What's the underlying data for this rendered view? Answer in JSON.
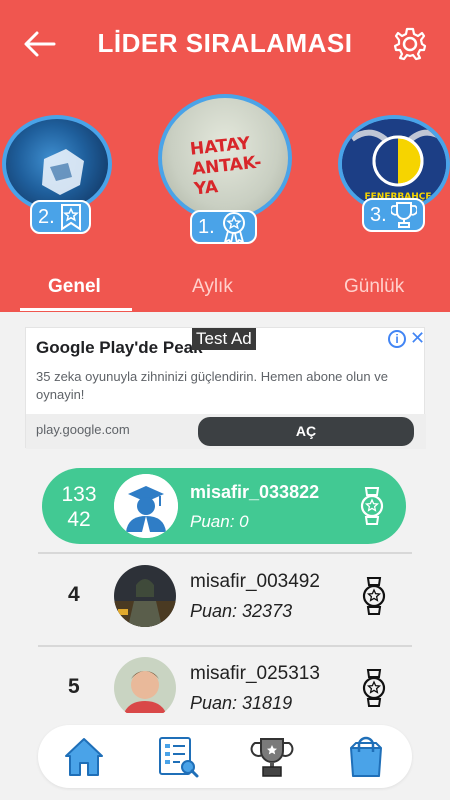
{
  "header": {
    "title": "LİDER SIRALAMASI",
    "back_icon": "arrow-left-icon",
    "settings_icon": "gear-icon",
    "background_color": "#f0564f"
  },
  "podium": [
    {
      "rank": "1.",
      "graffiti": "HATAY\nANTAK-\nYA",
      "badge_icon": "medal-ribbon-icon"
    },
    {
      "rank": "2.",
      "badge_icon": "ribbon-star-icon"
    },
    {
      "rank": "3.",
      "crest_text": "FENERBAHÇE",
      "badge_icon": "trophy-icon"
    }
  ],
  "tabs": [
    {
      "label": "Genel",
      "active": true
    },
    {
      "label": "Aylık",
      "active": false
    },
    {
      "label": "Günlük",
      "active": false
    }
  ],
  "ad": {
    "test_label": "Test Ad",
    "title": "Google Play'de Peak",
    "description": "35 zeka oyunuyla zihninizi güçlendirin. Hemen abone olun ve oynayin!",
    "url": "play.google.com",
    "cta": "AÇ",
    "info_icon": "info-icon",
    "close_icon": "close-icon"
  },
  "current_user": {
    "rank_line1": "133",
    "rank_line2": "42",
    "name": "misafir_033822",
    "score": "Puan: 0",
    "accent_color": "#42c993"
  },
  "leaderboard": [
    {
      "rank": "4",
      "name": "misafir_003492",
      "score": "Puan: 32373"
    },
    {
      "rank": "5",
      "name": "misafir_025313",
      "score": "Puan: 31819"
    }
  ],
  "bottom_nav": [
    {
      "icon": "home-icon"
    },
    {
      "icon": "list-search-icon"
    },
    {
      "icon": "trophy-icon"
    },
    {
      "icon": "shopping-bag-icon"
    }
  ]
}
